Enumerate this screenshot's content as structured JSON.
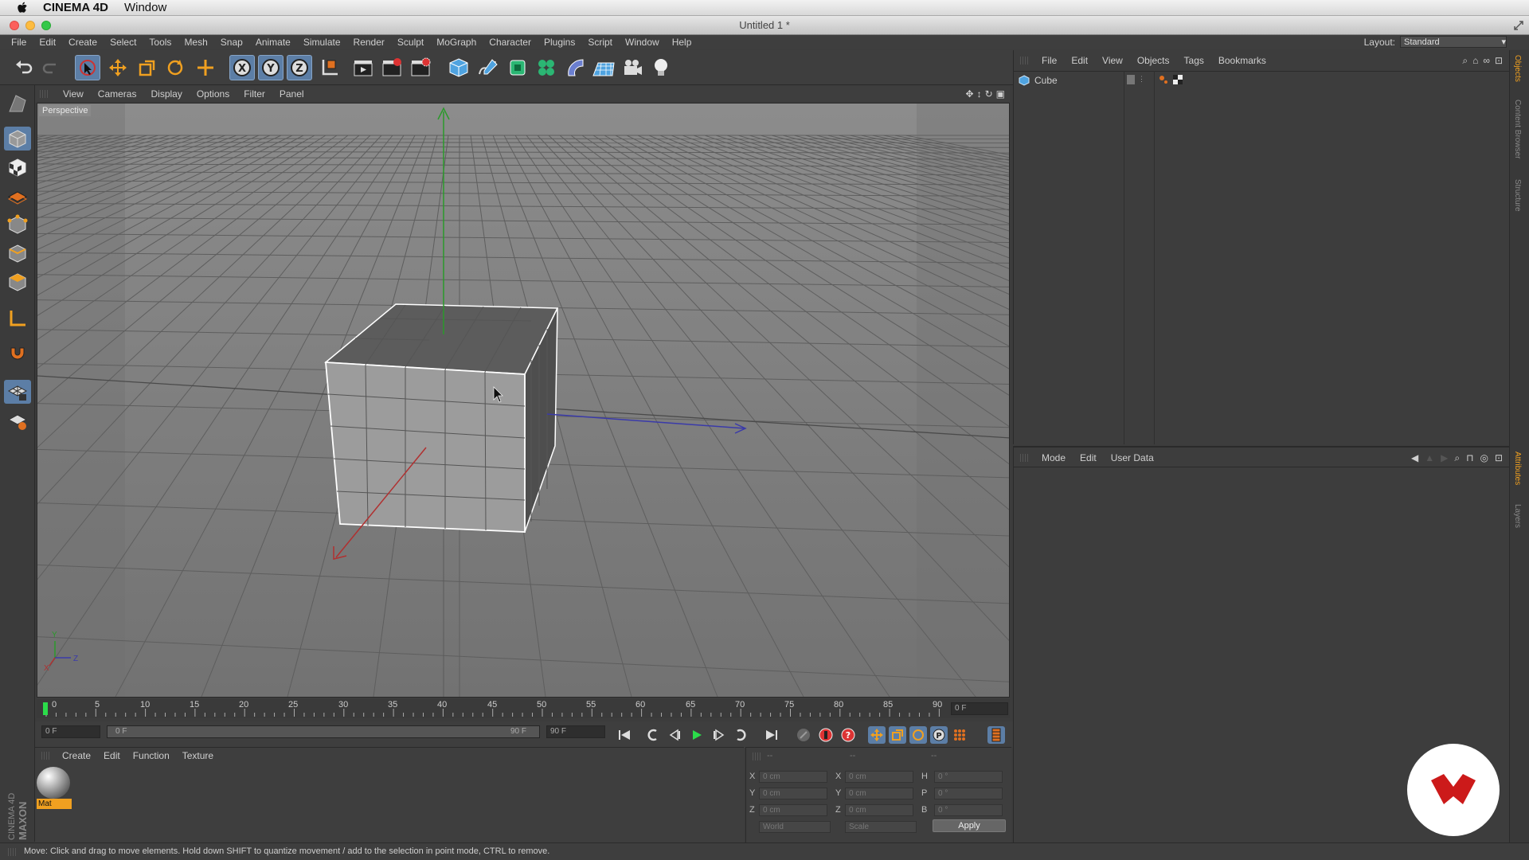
{
  "macos": {
    "app_name": "CINEMA 4D",
    "menu": "Window"
  },
  "window": {
    "title": "Untitled 1 *"
  },
  "menubar": {
    "items": [
      "File",
      "Edit",
      "Create",
      "Select",
      "Tools",
      "Mesh",
      "Snap",
      "Animate",
      "Simulate",
      "Render",
      "Sculpt",
      "MoGraph",
      "Character",
      "Plugins",
      "Script",
      "Window",
      "Help"
    ],
    "layout_label": "Layout:",
    "layout_value": "Standard"
  },
  "viewport": {
    "menu": [
      "View",
      "Cameras",
      "Display",
      "Options",
      "Filter",
      "Panel"
    ],
    "label": "Perspective",
    "axis_labels": {
      "y": "Y",
      "x": "X",
      "z": "Z"
    }
  },
  "timeline": {
    "ticks": [
      "0",
      "5",
      "10",
      "15",
      "20",
      "25",
      "30",
      "35",
      "40",
      "45",
      "50",
      "55",
      "60",
      "65",
      "70",
      "75",
      "80",
      "85",
      "90"
    ],
    "current_frame": "0 F"
  },
  "playback": {
    "start": "0 F",
    "range_start": "0 F",
    "range_end": "90 F",
    "end": "90 F"
  },
  "materials": {
    "menu": [
      "Create",
      "Edit",
      "Function",
      "Texture"
    ],
    "items": [
      {
        "name": "Mat"
      }
    ]
  },
  "coordinates": {
    "headers": [
      "--",
      "--",
      "--"
    ],
    "rows": [
      {
        "axis": "X",
        "pos": "0 cm",
        "axis2": "X",
        "size": "0 cm",
        "rot_label": "H",
        "rot": "0 °"
      },
      {
        "axis": "Y",
        "pos": "0 cm",
        "axis2": "Y",
        "size": "0 cm",
        "rot_label": "P",
        "rot": "0 °"
      },
      {
        "axis": "Z",
        "pos": "0 cm",
        "axis2": "Z",
        "size": "0 cm",
        "rot_label": "B",
        "rot": "0 °"
      }
    ],
    "mode": "World",
    "size_mode": "Scale",
    "apply_label": "Apply"
  },
  "objects": {
    "menu": [
      "File",
      "Edit",
      "View",
      "Objects",
      "Tags",
      "Bookmarks"
    ],
    "items": [
      {
        "name": "Cube"
      }
    ]
  },
  "attributes": {
    "menu": [
      "Mode",
      "Edit",
      "User Data"
    ]
  },
  "right_tabs": [
    "Objects",
    "Content Browser",
    "Structure",
    "Attributes",
    "Layers"
  ],
  "sidebar_brand": {
    "line1": "MAXON",
    "line2": "CINEMA 4D"
  },
  "status": {
    "text": "Move: Click and drag to move elements. Hold down SHIFT to quantize movement / add to the selection in point mode, CTRL to remove."
  },
  "colors": {
    "accent": "#5c7ea6",
    "bg": "#3c3c3c",
    "viewport": "#777777",
    "logo_red": "#cc1a1a"
  }
}
